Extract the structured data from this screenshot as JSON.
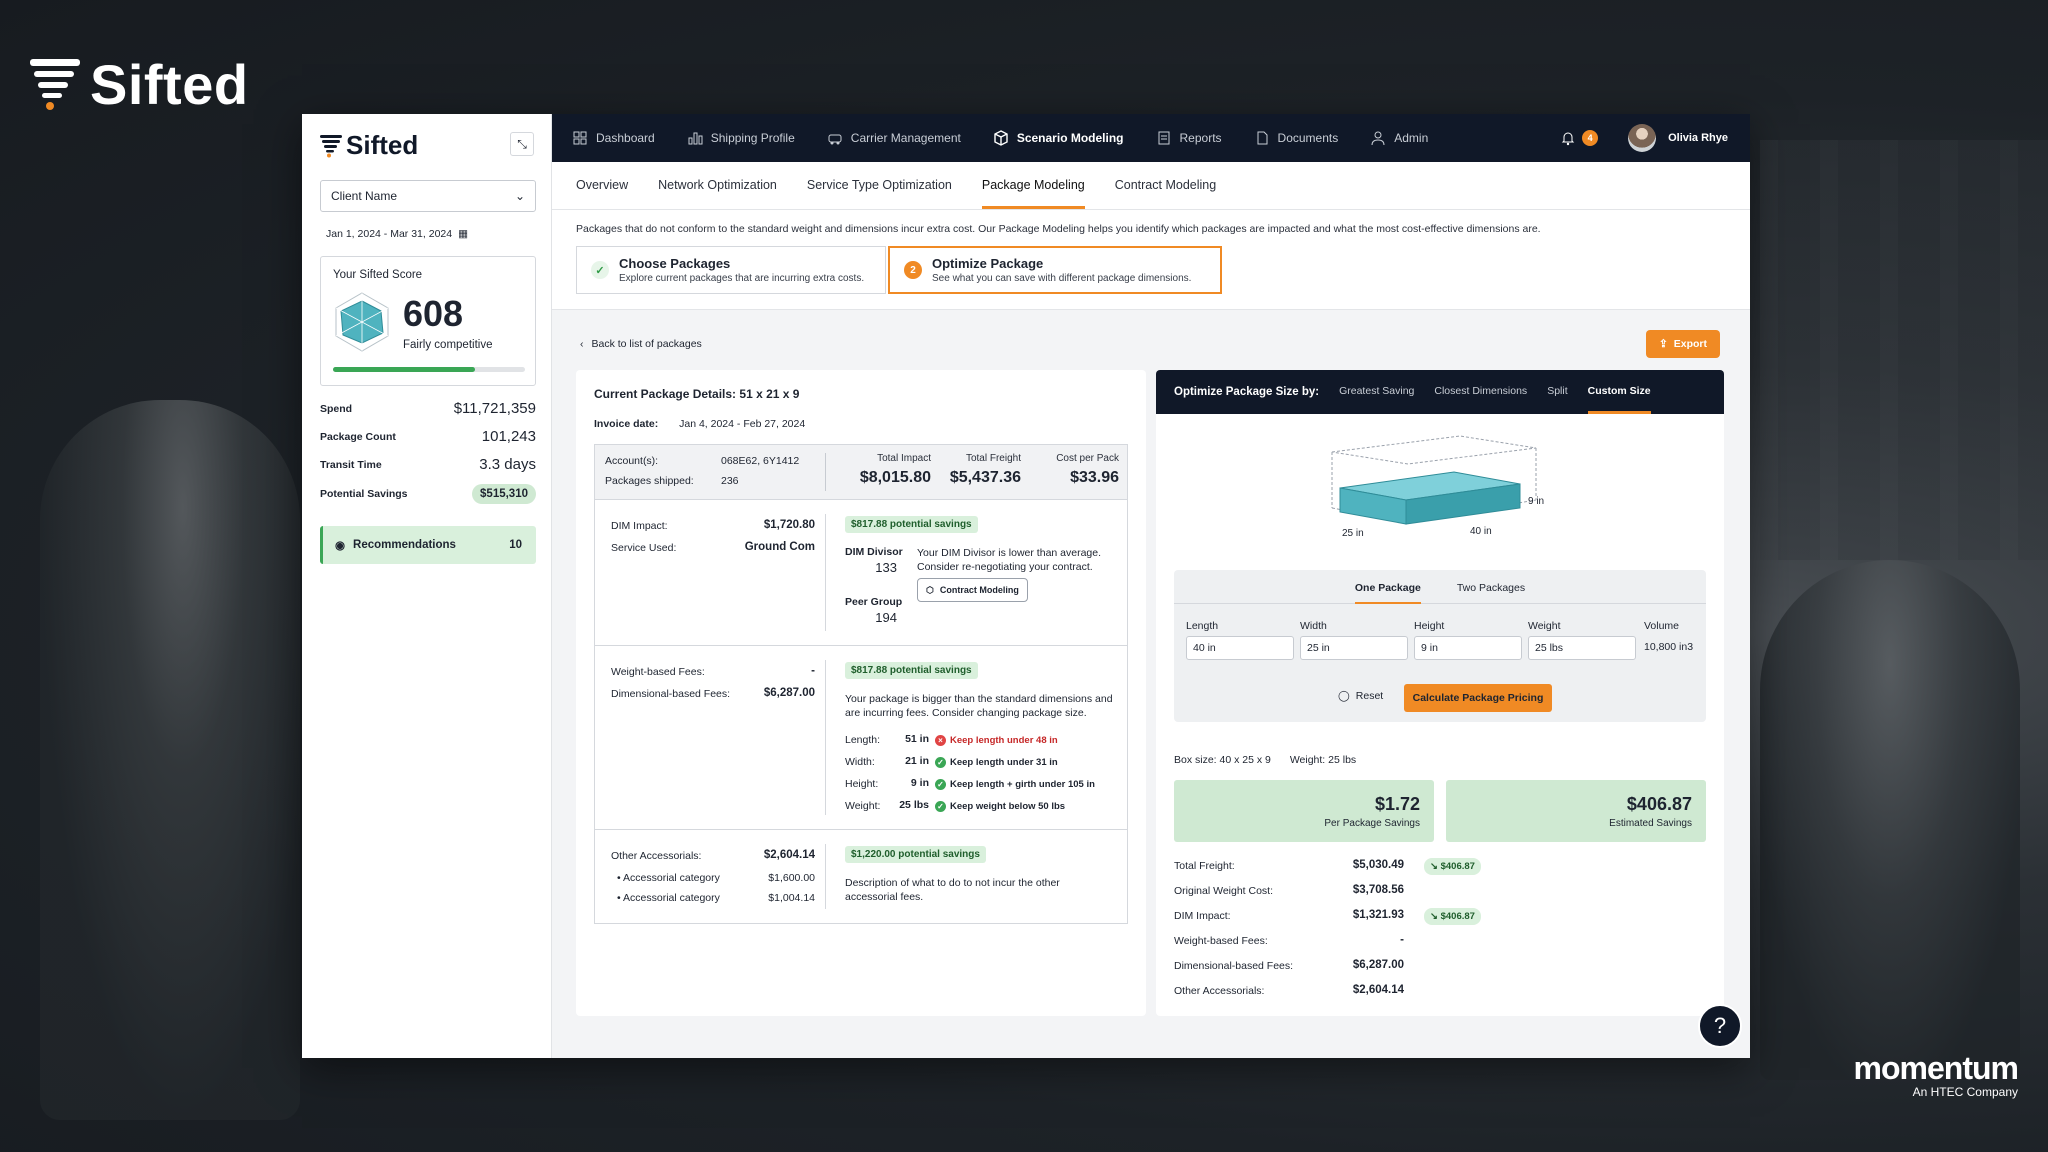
{
  "brand": {
    "name": "Sifted"
  },
  "footer_brand": {
    "name": "momentum",
    "sub": "An HTEC Company"
  },
  "colors": {
    "accent": "#f08a24",
    "nav_bg": "#101828",
    "success": "#3aa655",
    "success_bg": "#cfe9d2"
  },
  "sidebar": {
    "logo": "Sifted",
    "client_select": "Client Name",
    "date_range": "Jan 1, 2024 - Mar 31, 2024",
    "score": {
      "title": "Your Sifted Score",
      "value": "608",
      "label": "Fairly competitive",
      "progress": 0.74
    },
    "metrics": [
      {
        "label": "Spend",
        "value": "$11,721,359"
      },
      {
        "label": "Package Count",
        "value": "101,243"
      },
      {
        "label": "Transit Time",
        "value": "3.3 days"
      },
      {
        "label": "Potential Savings",
        "value": "$515,310"
      }
    ],
    "recommendations": {
      "label": "Recommendations",
      "count": "10"
    }
  },
  "topnav": {
    "items": [
      {
        "label": "Dashboard",
        "icon": "dashboard-icon"
      },
      {
        "label": "Shipping Profile",
        "icon": "bar-chart-icon"
      },
      {
        "label": "Carrier Management",
        "icon": "truck-icon"
      },
      {
        "label": "Scenario Modeling",
        "icon": "cube-icon",
        "active": true
      },
      {
        "label": "Reports",
        "icon": "report-icon"
      },
      {
        "label": "Documents",
        "icon": "document-icon"
      },
      {
        "label": "Admin",
        "icon": "user-icon"
      }
    ],
    "notifications": "4",
    "user_name": "Olivia Rhye"
  },
  "subtabs": [
    "Overview",
    "Network Optimization",
    "Service Type Optimization",
    "Package Modeling",
    "Contract Modeling"
  ],
  "intro": "Packages that do not conform to the standard weight and dimensions incur extra cost. Our Package Modeling helps you identify which packages are impacted and what the most cost-effective dimensions are.",
  "steps": [
    {
      "title": "Choose Packages",
      "desc": "Explore current packages that are incurring extra costs."
    },
    {
      "num": "2",
      "title": "Optimize Package",
      "desc": "See what you can save with different package dimensions."
    }
  ],
  "back_link": "Back to list of packages",
  "export_label": "Export",
  "current": {
    "title": "Current Package Details: 51 x 21 x 9",
    "invoice_label": "Invoice date:",
    "invoice_value": "Jan 4, 2024 - Feb 27, 2024",
    "accounts_label": "Account(s):",
    "accounts_value": "068E62, 6Y1412",
    "shipped_label": "Packages shipped:",
    "shipped_value": "236",
    "total_impact_label": "Total Impact",
    "total_impact": "$8,015.80",
    "total_freight_label": "Total Freight",
    "total_freight": "$5,437.36",
    "cpp_label": "Cost per Pack",
    "cpp": "$33.96",
    "dim": {
      "impact_label": "DIM Impact:",
      "impact": "$1,720.80",
      "service_label": "Service Used:",
      "service": "Ground Com",
      "savings": "$817.88 potential savings",
      "divisor_label": "DIM Divisor",
      "divisor": "133",
      "peer_label": "Peer Group",
      "peer": "194",
      "note": "Your DIM Divisor is lower than average. Consider re-negotiating your contract.",
      "button": "Contract Modeling"
    },
    "fees": {
      "weight_label": "Weight-based Fees:",
      "weight": "-",
      "dim_label": "Dimensional-based Fees:",
      "dim": "$6,287.00",
      "savings": "$817.88 potential savings",
      "note": "Your package is bigger than the standard dimensions and are incurring fees. Consider changing package size.",
      "rows": [
        {
          "label": "Length:",
          "value": "51 in",
          "status": "fail",
          "msg": "Keep length under 48 in"
        },
        {
          "label": "Width:",
          "value": "21 in",
          "status": "ok",
          "msg": "Keep length under 31 in"
        },
        {
          "label": "Height:",
          "value": "9 in",
          "status": "ok",
          "msg": "Keep length + girth under 105 in"
        },
        {
          "label": "Weight:",
          "value": "25 lbs",
          "status": "ok",
          "msg": "Keep weight below 50 lbs"
        }
      ]
    },
    "acc": {
      "label": "Other Accessorials:",
      "value": "$2,604.14",
      "items": [
        {
          "label": "Accessorial category",
          "value": "$1,600.00"
        },
        {
          "label": "Accessorial category",
          "value": "$1,004.14"
        }
      ],
      "savings": "$1,220.00 potential savings",
      "note": "Description of what to do to not incur the other accessorial fees."
    }
  },
  "optimize": {
    "lead": "Optimize Package Size by:",
    "tabs": [
      "Greatest Saving",
      "Closest Dimensions",
      "Split",
      "Custom Size"
    ],
    "box_labels": {
      "h": "9 in",
      "w": "25 in",
      "l": "40 in"
    },
    "inner_tabs": [
      "One Package",
      "Two Packages"
    ],
    "fields": [
      {
        "label": "Length",
        "value": "40 in"
      },
      {
        "label": "Width",
        "value": "25 in"
      },
      {
        "label": "Height",
        "value": "9 in"
      },
      {
        "label": "Weight",
        "value": "25 lbs"
      }
    ],
    "volume_label": "Volume",
    "volume": "10,800 in3",
    "reset": "Reset",
    "calc": "Calculate Package Pricing",
    "box_size": "Box size: 40 x 25 x 9",
    "box_weight": "Weight: 25 lbs",
    "per_pkg": "$1.72",
    "per_pkg_label": "Per Package Savings",
    "est": "$406.87",
    "est_label": "Estimated Savings",
    "stats": [
      {
        "label": "Total Freight:",
        "value": "$5,030.49",
        "delta": "$406.87"
      },
      {
        "label": "Original Weight Cost:",
        "value": "$3,708.56"
      },
      {
        "label": "DIM Impact:",
        "value": "$1,321.93",
        "delta": "$406.87"
      },
      {
        "label": "Weight-based Fees:",
        "value": "-"
      },
      {
        "label": "Dimensional-based Fees:",
        "value": "$6,287.00"
      },
      {
        "label": "Other Accessorials:",
        "value": "$2,604.14"
      }
    ]
  }
}
